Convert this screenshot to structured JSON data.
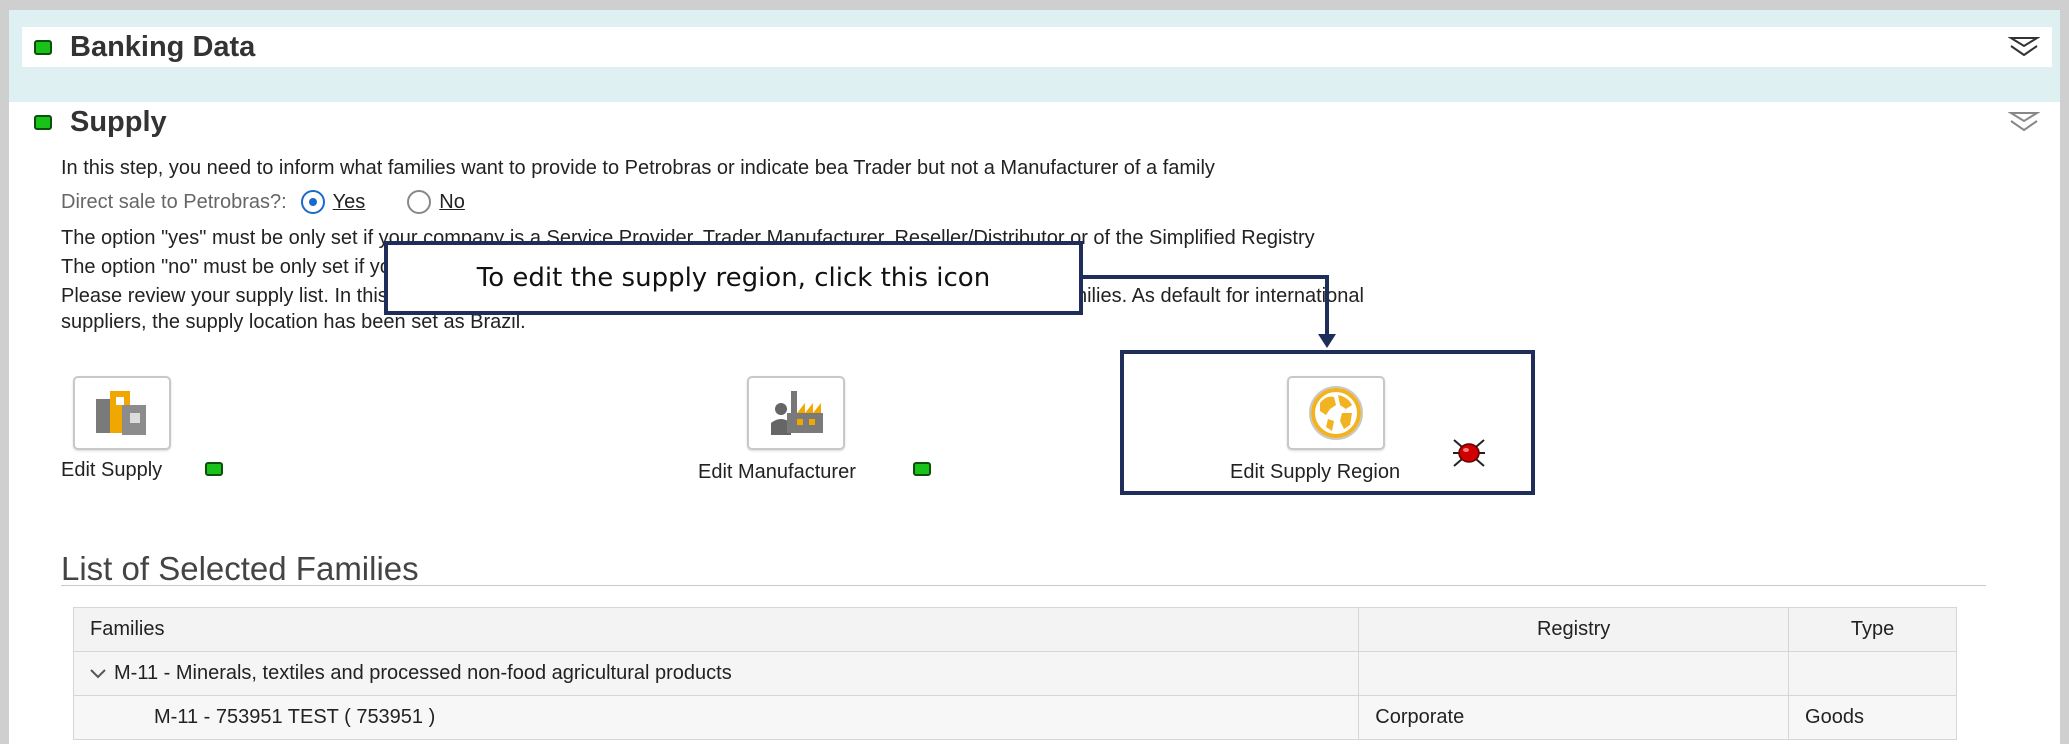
{
  "banking": {
    "title": "Banking Data"
  },
  "supply": {
    "title": "Supply",
    "intro": "In this step, you need to inform what families want to provide to Petrobras or indicate bea Trader but not a Manufacturer of a family",
    "direct_sale_label": "Direct sale to Petrobras?:",
    "radio_yes": "Yes",
    "radio_no": "No",
    "selected_option": "Yes",
    "option_yes_text": "The option \"yes\" must be only set if your company is a Service Provider, Trader Manufacturer, Reseller/Distributor or of the Simplified Registry",
    "option_no_text": "The option \"no\" must be only set if your company is a Service Provider of the Corporate Registry",
    "review_text_1": "Please review your supply list. In this area you can also edit and change the supply location information for your families. As default for international",
    "review_text_2": "suppliers, the supply location has been set as Brazil."
  },
  "actions": {
    "edit_supply": "Edit Supply",
    "edit_manufacturer": "Edit Manufacturer",
    "edit_supply_region": "Edit Supply Region"
  },
  "callout": {
    "text": "To edit the supply region, click this icon"
  },
  "families_list": {
    "title": "List of Selected Families",
    "columns": [
      "Families",
      "Registry",
      "Type"
    ],
    "group": {
      "label": "M-11 - Minerals, textiles and processed non-food agricultural products"
    },
    "rows": [
      {
        "family": "M-11 - 753951  TEST ( 753951 )",
        "registry": "Corporate",
        "type": "Goods"
      }
    ]
  },
  "colors": {
    "status_ok": "#19c219",
    "status_error": "#d00000",
    "callout_border": "#1f2d5a",
    "header_band": "#dff0f3",
    "globe": "#f2b320"
  },
  "icons": [
    "collapse-chevrons-icon",
    "supply-building-icon",
    "manufacturer-factory-icon",
    "globe-icon",
    "error-bug-icon",
    "chevron-down-icon"
  ]
}
